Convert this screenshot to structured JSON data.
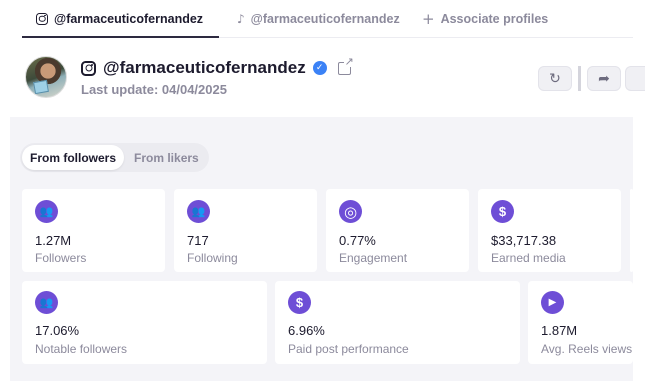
{
  "tabs": [
    {
      "label": "@farmaceuticofernandez",
      "icon": "instagram-icon",
      "active": true
    },
    {
      "label": "@farmaceuticofernandez",
      "icon": "tiktok-icon",
      "active": false
    },
    {
      "label": "Associate profiles",
      "icon": "plus-icon",
      "active": false
    }
  ],
  "profile": {
    "handle": "@farmaceuticofernandez",
    "verified_glyph": "✓",
    "last_update": "Last update: 04/04/2025"
  },
  "actions": {
    "refresh_icon": "↻",
    "share_icon": "➦"
  },
  "segment": {
    "options": [
      "From followers",
      "From likers"
    ],
    "selected": "From followers"
  },
  "metrics_row1": [
    {
      "value": "1.27M",
      "label": "Followers",
      "icon": "users-icon",
      "glyph": "👥"
    },
    {
      "value": "717",
      "label": "Following",
      "icon": "users-icon",
      "glyph": "👥"
    },
    {
      "value": "0.77%",
      "label": "Engagement",
      "icon": "target-icon",
      "glyph": "◎"
    },
    {
      "value": "$33,717.38",
      "label": "Earned media",
      "icon": "dollar-icon",
      "glyph": "$"
    }
  ],
  "metrics_row2": [
    {
      "value": "17.06%",
      "label": "Notable followers",
      "icon": "users-icon",
      "glyph": "👥"
    },
    {
      "value": "6.96%",
      "label": "Paid post performance",
      "icon": "dollar-icon",
      "glyph": "$"
    },
    {
      "value": "1.87M",
      "label": "Avg. Reels views",
      "icon": "play-icon",
      "glyph": "▶"
    }
  ],
  "colors": {
    "accent": "#6e4ed6",
    "verified": "#3b82f6",
    "panel_bg": "#f4f4f8",
    "muted_text": "#8c8a9c"
  }
}
